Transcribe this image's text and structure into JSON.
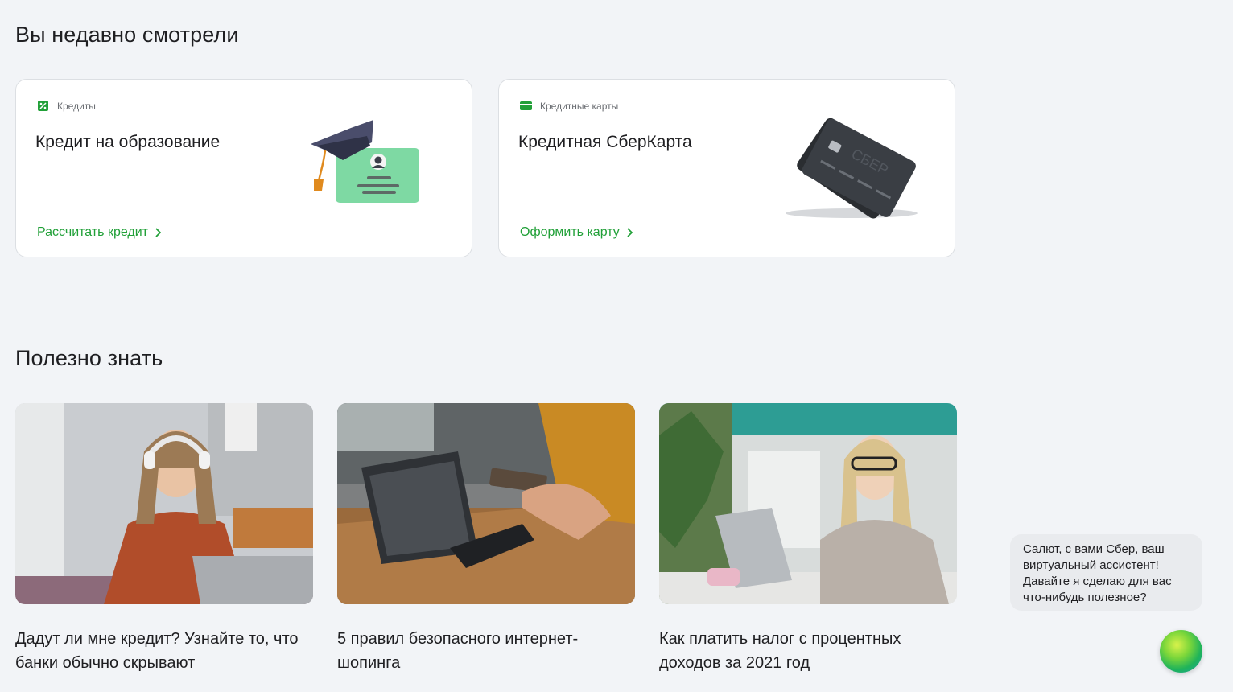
{
  "recent": {
    "title": "Вы недавно смотрели",
    "cards": [
      {
        "category": "Кредиты",
        "title": "Кредит на образование",
        "cta": "Рассчитать кредит",
        "category_icon": "percent-icon"
      },
      {
        "category": "Кредитные карты",
        "title": "Кредитная СберКарта",
        "cta": "Оформить карту",
        "category_icon": "card-icon"
      }
    ]
  },
  "useful": {
    "title": "Полезно знать",
    "articles": [
      {
        "title": "Дадут ли мне кредит? Узнайте то, что банки обычно скрывают"
      },
      {
        "title": "5 правил безопасного интернет-шопинга"
      },
      {
        "title": "Как платить налог с процентных доходов за 2021 год"
      }
    ]
  },
  "assistant": {
    "message": "Салют, с вами Сбер, ваш виртуальный ассистент! Давайте я сделаю для вас что-нибудь полезное?"
  },
  "colors": {
    "accent": "#21a038",
    "background": "#f2f4f7",
    "card": "#ffffff"
  }
}
